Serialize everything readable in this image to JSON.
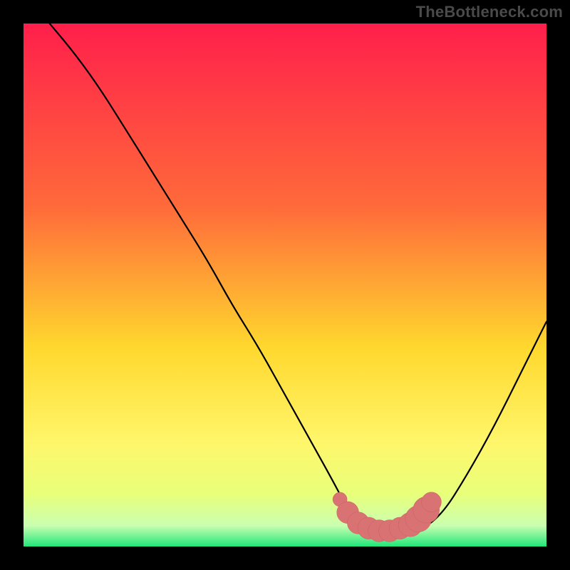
{
  "watermark": "TheBottleneck.com",
  "colors": {
    "frame": "#000000",
    "grad_top": "#ff1f4b",
    "grad_mid1": "#ff6a3a",
    "grad_mid2": "#ffd82e",
    "grad_mid3": "#fff66a",
    "grad_mid4": "#e8ff7a",
    "grad_low": "#caffb0",
    "grad_bottom": "#20e67a",
    "curve": "#000000",
    "marker_fill": "#d97373",
    "marker_stroke": "#c85f5f"
  },
  "chart_data": {
    "type": "line",
    "title": "",
    "xlabel": "",
    "ylabel": "",
    "xlim": [
      0,
      100
    ],
    "ylim": [
      0,
      100
    ],
    "series": [
      {
        "name": "bottleneck-curve",
        "x": [
          5,
          10,
          15,
          20,
          25,
          30,
          35,
          40,
          45,
          50,
          55,
          60,
          62,
          65,
          70,
          72,
          75,
          80,
          85,
          90,
          95,
          100
        ],
        "y": [
          100,
          94,
          87,
          79,
          71,
          63,
          55,
          46,
          38,
          29,
          20,
          11,
          7,
          4,
          2,
          2,
          2.5,
          6,
          14,
          23,
          33,
          43
        ]
      }
    ],
    "markers": {
      "name": "highlight-overlay",
      "points": [
        {
          "x": 60.5,
          "y": 9,
          "r": 1.3
        },
        {
          "x": 62,
          "y": 6.5,
          "r": 2.0
        },
        {
          "x": 64,
          "y": 4.5,
          "r": 2.0
        },
        {
          "x": 66,
          "y": 3.5,
          "r": 2.0
        },
        {
          "x": 68,
          "y": 3.0,
          "r": 2.0
        },
        {
          "x": 70,
          "y": 3.0,
          "r": 2.0
        },
        {
          "x": 72,
          "y": 3.5,
          "r": 2.0
        },
        {
          "x": 74,
          "y": 4.2,
          "r": 2.2
        },
        {
          "x": 75.5,
          "y": 5.3,
          "r": 2.4
        },
        {
          "x": 77,
          "y": 7.0,
          "r": 2.4
        },
        {
          "x": 78,
          "y": 8.5,
          "r": 1.8
        }
      ]
    }
  }
}
